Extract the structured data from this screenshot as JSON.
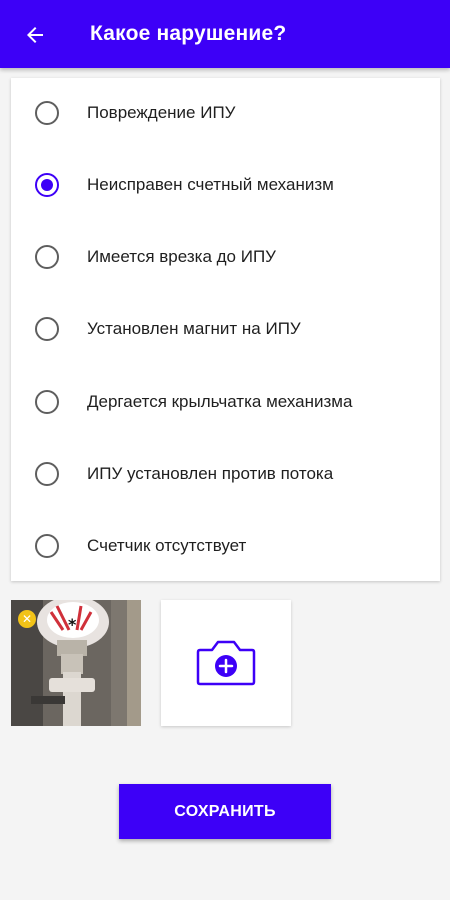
{
  "appbar": {
    "back_icon": "arrow-left-icon",
    "title": "Какое нарушение?",
    "color": "#3d00f7"
  },
  "violations": {
    "selected_index": 1,
    "options": [
      {
        "label": "Повреждение ИПУ",
        "selected": false
      },
      {
        "label": "Неисправен счетный механизм",
        "selected": true
      },
      {
        "label": "Имеется врезка до ИПУ",
        "selected": false
      },
      {
        "label": "Установлен магнит на ИПУ",
        "selected": false
      },
      {
        "label": "Дергается крыльчатка механизма",
        "selected": false
      },
      {
        "label": "ИПУ установлен против потока",
        "selected": false
      },
      {
        "label": "Счетчик отсутствует",
        "selected": false
      }
    ]
  },
  "photos": {
    "thumbnail_icon": "water-meter-photo",
    "remove_icon": "close-icon",
    "remove_badge_color": "#f2c318",
    "add_icon": "camera-add-icon"
  },
  "actions": {
    "save_label": "СОХРАНИТЬ"
  }
}
